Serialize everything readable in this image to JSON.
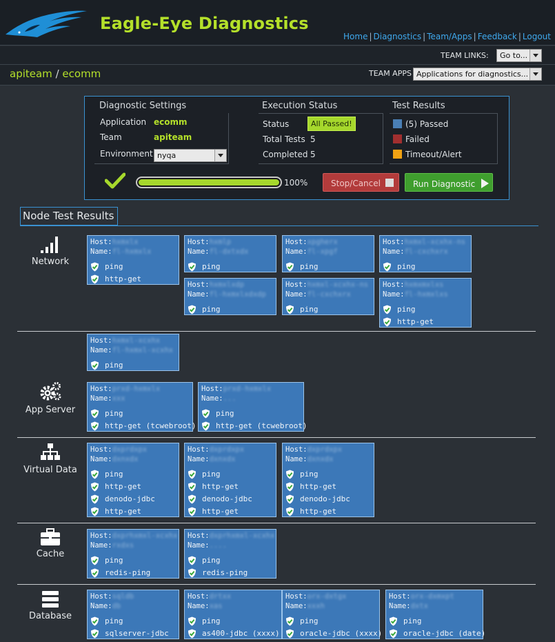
{
  "header": {
    "app_title": "Eagle-Eye Diagnostics",
    "nav": [
      "Home",
      "Diagnostics",
      "Team/Apps",
      "Feedback",
      "Logout"
    ],
    "team_links_label": "TEAM LINKS:",
    "team_links_select": "Go to...",
    "team_apps_label": "TEAM APPS",
    "team_apps_select": "Applications for diagnostics..."
  },
  "breadcrumb": {
    "team": "apiteam",
    "app": "ecomm"
  },
  "diagnostic_settings": {
    "title": "Diagnostic Settings",
    "application_label": "Application",
    "application_value": "ecomm",
    "team_label": "Team",
    "team_value": "apiteam",
    "environment_label": "Environment",
    "environment_value": "nyqa"
  },
  "execution_status": {
    "title": "Execution Status",
    "status_label": "Status",
    "status_value": "All Passed!",
    "total_label": "Total Tests",
    "total_value": "5",
    "completed_label": "Completed",
    "completed_value": "5"
  },
  "test_results": {
    "title": "Test Results",
    "legend": [
      {
        "label": "(5) Passed",
        "color": "#4a7fb5"
      },
      {
        "label": "Failed",
        "color": "#a12f2f"
      },
      {
        "label": "Timeout/Alert",
        "color": "#f2a213"
      }
    ]
  },
  "progress": {
    "percent": 100,
    "label": "100%"
  },
  "buttons": {
    "stop": "Stop/Cancel",
    "run": "Run Diagnostic"
  },
  "node_results": {
    "title": "Node Test Results",
    "host_label": "Host:",
    "name_label": "Name:",
    "categories": [
      {
        "label": "Network",
        "icon": "signal-bars-icon"
      },
      {
        "label": "App Server",
        "icon": "gears-icon"
      },
      {
        "label": "Virtual Data",
        "icon": "sitemap-icon"
      },
      {
        "label": "Cache",
        "icon": "briefcase-icon"
      },
      {
        "label": "Database",
        "icon": "database-icon"
      }
    ],
    "cards": [
      {
        "host": "hxmxlx",
        "name": "fl-hxmxlx",
        "tests": [
          "ping",
          "http-get"
        ]
      },
      {
        "host": "hxmlp",
        "name": "fl-dxtxdx",
        "tests": [
          "ping"
        ]
      },
      {
        "host": "xpgherx",
        "name": "fl-xpgf",
        "tests": [
          "ping"
        ]
      },
      {
        "host": "hxmxl-xcxhx-ns",
        "name": "fl-cxchxrx",
        "tests": [
          "ping"
        ]
      },
      {
        "host": "hxmxlxdp",
        "name": "fl-hxmxlxdxdp",
        "tests": [
          "ping"
        ]
      },
      {
        "host": "hxmxl-xcxhx-ns",
        "name": "fl-cxchxrx",
        "tests": [
          "ping"
        ]
      },
      {
        "host": "hxmxmxlxs",
        "name": "fl-hxmxlxs",
        "tests": [
          "ping",
          "http-get"
        ]
      },
      {
        "host": "hxmxl-xcxhx",
        "name": "fl-hxmxl-xcxhx",
        "tests": [
          "ping"
        ]
      },
      {
        "host": "prxd-hxmxlx",
        "name": "xxx",
        "tests": [
          "ping",
          "http-get (tcwebroot)"
        ]
      },
      {
        "host": "prxd-hxmxlx",
        "name": "...",
        "tests": [
          "ping",
          "http-get (tcwebroot)"
        ]
      },
      {
        "host": "dxprdxpx",
        "name": "dxnxdx",
        "tests": [
          "ping",
          "http-get",
          "denodo-jdbc",
          "http-get"
        ]
      },
      {
        "host": "dxprdxpx",
        "name": "dxnxdx",
        "tests": [
          "ping",
          "http-get",
          "denodo-jdbc",
          "http-get"
        ]
      },
      {
        "host": "dxprdxpx",
        "name": "dxnxdx",
        "tests": [
          "ping",
          "http-get",
          "denodo-jdbc",
          "http-get"
        ]
      },
      {
        "host": "dxprhxmxl-xcxhx",
        "name": "rxdxs",
        "tests": [
          "ping",
          "redis-ping"
        ]
      },
      {
        "host": "dxprhxmxl-xcxhx",
        "name": "....",
        "tests": [
          "ping",
          "redis-ping"
        ]
      },
      {
        "host": "sqldb",
        "name": "db",
        "tests": [
          "ping",
          "sqlserver-jdbc"
        ]
      },
      {
        "host": "drtxx",
        "name": "xas",
        "tests": [
          "ping",
          "as400-jdbc (xxxx)"
        ]
      },
      {
        "host": "orx-dxtgx",
        "name": "xxxh",
        "tests": [
          "ping",
          "oracle-jdbc (xxxx)"
        ]
      },
      {
        "host": "orx-dxmxpt",
        "name": "dxtx",
        "tests": [
          "ping",
          "oracle-jdbc (date)"
        ]
      }
    ]
  }
}
